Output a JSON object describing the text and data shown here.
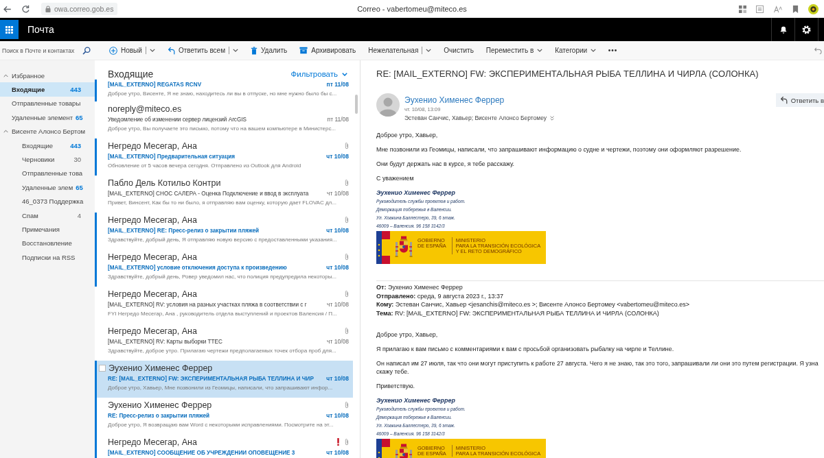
{
  "browser": {
    "url": "owa.correo.gob.es",
    "title": "Correo - vabertomeu@miteco.es"
  },
  "app_bar": {
    "title": "Почта"
  },
  "toolbar": {
    "search": {
      "placeholder": "Поиск в Почте и контактах"
    },
    "buttons": [
      {
        "kind": "new",
        "label": "Новый"
      },
      {
        "kind": "replyall",
        "label": "Ответить всем"
      },
      {
        "kind": "delete",
        "label": "Удалить"
      },
      {
        "kind": "archive",
        "label": "Архивировать"
      },
      {
        "kind": "junk",
        "label": "Нежелательная"
      },
      {
        "kind": "sweep",
        "label": "Очистить"
      },
      {
        "kind": "move",
        "label": "Переместить в"
      },
      {
        "kind": "categories",
        "label": "Категории"
      },
      {
        "kind": "more"
      }
    ]
  },
  "folder_pane": {
    "sections": [
      {
        "kind": "favorites",
        "label": "Избранное",
        "expanded": true,
        "children": [
          {
            "label": "Входящие",
            "count": "443",
            "count_unread": true,
            "selected": true
          },
          {
            "label": "Отправленные товары",
            "selected": false
          },
          {
            "label": "Удаленные элемент",
            "count": "65",
            "count_unread": true,
            "selected": false
          }
        ]
      },
      {
        "kind": "account",
        "label": "Висенте Алонсо Бертом",
        "expanded": true,
        "children": [
          {
            "label": "Входящие",
            "count": "443",
            "count_unread": true,
            "selected": false
          },
          {
            "label": "Черновики",
            "count": "30",
            "count_unread": false,
            "selected": false
          },
          {
            "label": "Отправленные това",
            "selected": false
          },
          {
            "label": "Удаленные элем",
            "count": "65",
            "count_unread": true,
            "selected": false
          },
          {
            "label": "46_0373 Поддержка",
            "selected": false
          },
          {
            "label": "Спам",
            "count": "4",
            "count_unread": false,
            "selected": false
          },
          {
            "label": "Примечания",
            "selected": false
          },
          {
            "label": "Восстановление",
            "selected": false
          },
          {
            "label": "Подписки на RSS",
            "selected": false
          }
        ]
      }
    ]
  },
  "message_list": {
    "title": "Входящие",
    "filter": "Фильтровать",
    "messages": [
      {
        "subject": "[MAIL_EXTERNO] REGATAS RCNV",
        "date": "пт 11/08",
        "preview": "Доброе утро, Висенте, Я не знаю, находитесь ли вы в отпуске, но мне нужно было бы с...",
        "unread": true,
        "selected": false,
        "attachment": false,
        "important": false
      },
      {
        "sender": "noreply@miteco.es",
        "subject": "Уведомление об изменении сервер лицензий ArcGIS",
        "date": "пт 11/08",
        "preview": "Доброе утро, Вы получаете это письмо, потому что на вашем компьютере в Министерс...",
        "unread": false,
        "selected": false,
        "attachment": false,
        "important": false
      },
      {
        "sender": "Негредо Месегар, Ана",
        "subject": "[MAIL_EXTERNO] Предварительная ситуация",
        "date": "чт 10/08",
        "preview": "Обновление от 5 часов вечера сегодня. Отправлено из Outlook для Android",
        "unread": true,
        "selected": false,
        "attachment": true,
        "important": false
      },
      {
        "sender": "Пабло Дель Котильо Контри",
        "subject": "[MAIL_EXTERNO] СНОС САЛЕРА - Оценка Подключение и ввод в эксплуата",
        "date": "чт 10/08",
        "preview": "Привет, Винсент, Как бы то ни было, я отправляю вам оценку, которую дает FLOVAC дл...",
        "unread": false,
        "selected": false,
        "attachment": true,
        "important": false
      },
      {
        "sender": "Негредо Месегар, Ана",
        "subject": "[MAIL_EXTERNO] RE: Пресс-релиз о закрытии пляжей",
        "date": "чт 10/08",
        "preview": "Здравствуйте, добрый день, Я отправляю новую версию с предоставленными указания...",
        "unread": true,
        "selected": false,
        "attachment": true,
        "important": false
      },
      {
        "sender": "Негредо Месегар, Ана",
        "subject": "[MAIL_EXTERNO] условие отключения доступа к произведению",
        "date": "чт 10/08",
        "preview": "Здравствуйте, добрый день, Ровер уведомил нас, что полиция предупредила некоторы...",
        "unread": true,
        "selected": false,
        "attachment": true,
        "important": false
      },
      {
        "sender": "Негредо Месегар, Ана",
        "subject": "[MAIL_EXTERNO] RV: условия на разных участках пляжа в соответствии с г",
        "date": "чт 10/08",
        "preview": "FYI Негредо Месегар, Ана , руководитель отдела выступлений и проектов Валенсия / П...",
        "unread": false,
        "selected": false,
        "attachment": true,
        "important": false
      },
      {
        "sender": "Негредо Месегар, Ана",
        "subject": "[MAIL_EXTERNO] RV: Карты выборки TTEC",
        "date": "чт 10/08",
        "preview": "Здравствуйте, доброе утро. Прилагаю чертежи предполагаемых точек отбора проб для...",
        "unread": false,
        "selected": false,
        "attachment": true,
        "important": false
      },
      {
        "sender": "Эухенио Хименес Феррер",
        "subject": "RE: [MAIL_EXTERNO] FW: ЭКСПЕРИМЕНТАЛЬНАЯ РЫБА ТЕЛЛИНА И ЧИР",
        "date": "чт 10/08",
        "preview": "Доброе утро, Хавьер, Мне позвонили из Геомицы, написали, что запрашивают инфор...",
        "unread": true,
        "selected": true,
        "attachment": false,
        "important": false
      },
      {
        "sender": "Эухенио Хименес Феррер",
        "subject": "RE: Пресс-релиз о закрытии пляжей",
        "date": "чт 10/08",
        "preview": "Доброе утро, Я возвращаю вам Word с некоторыми исправлениями. Посмотрите на эт...",
        "unread": true,
        "selected": false,
        "attachment": true,
        "important": false
      },
      {
        "sender": "Негредо Месегар, Ана",
        "subject": "[MAIL_EXTERNO] СООБЩЕНИЕ ОБ УЧРЕЖДЕНИИ ОПОВЕЩЕНИЕ 3",
        "date": "чт 10/08",
        "unread": true,
        "selected": false,
        "attachment": true,
        "important": true
      }
    ]
  },
  "reading_pane": {
    "subject": "RE: [MAIL_EXTERNO] FW: ЭКСПЕРИМЕНТАЛЬНАЯ РЫБА ТЕЛЛИНА И ЧИРЛА (СОЛОНКА)",
    "sender": "Эухенио Хименес Феррер",
    "sent": "чт. 10/08, 13:09",
    "recipients": "Эстеван Санчис, Хавьер; Висенте Алонсо Бертомеу",
    "reply_button": "Ответить в",
    "body": [
      {
        "kind": "paragraph",
        "lines": [
          "Доброе утро, Хавьер,"
        ]
      },
      {
        "kind": "paragraph",
        "lines": [
          "Мне позвонили из Геомицы, написали, что запрашивают информацию о судне и чертежи, поэтому они оформляют разрешение."
        ]
      },
      {
        "kind": "paragraph",
        "lines": [
          "Они будут держать нас в курсе, я тебе расскажу."
        ]
      },
      {
        "kind": "paragraph",
        "lines": [
          "С уважением"
        ]
      },
      {
        "kind": "signature",
        "name": "Эухенио Хименес Феррер",
        "lines": [
          "Руководитель службы проектов и работ.",
          "Деморкация побережья в Валенсии.",
          "Ул. Хоакина Баллестеро, 39, 6 этаж.",
          "46009 – Валенсия. 96 158 3142/3"
        ]
      },
      {
        "kind": "logo",
        "left": [
          "GOBIERNO",
          "DE ESPAÑA"
        ],
        "right": [
          "MINISTERIO",
          "PARA LA TRANSICIÓN ECOLÓGICA",
          "Y EL RETO DEMOGRÁFICO"
        ]
      },
      {
        "kind": "headers",
        "fields": [
          {
            "label": "От:",
            "value": "Эухенио Хименес Феррер"
          },
          {
            "label": "Отправлено:",
            "value": "среда, 9 августа 2023 г., 13:37"
          },
          {
            "label": "Кому:",
            "value": "Эстеван Санчис, Хавьер <jesanchis@miteco.es >; Висенте Алонсо Бертомеу <vabertomeu@miteco.es>"
          },
          {
            "label": "Тема:",
            "value": "RV: [MAIL_EXTERNO] FW: ЭКСПЕРИМЕНТАЛЬНАЯ РЫБА ТЕЛЛИНА И ЧИРЛА (СОЛОНКА)"
          }
        ]
      },
      {
        "kind": "paragraph",
        "lines": [
          "Доброе утро, Хавьер,"
        ]
      },
      {
        "kind": "paragraph",
        "lines": [
          "Я прилагаю к вам письмо с комментариями к вам с просьбой организовать рыбалку на чирле и Теллине."
        ]
      },
      {
        "kind": "paragraph",
        "lines": [
          "Он написал им 27 июля, так что они могут приступить к работе 27 августа. Чего я не знаю, так это того, запрашивали ли они это путем регистрации. Я узна",
          "скажу тебе."
        ]
      },
      {
        "kind": "paragraph",
        "lines": [
          "Приветствую."
        ]
      },
      {
        "kind": "signature",
        "name": "Эухенио Хименес Феррер",
        "lines": [
          "Руководитель службы проектов и работ.",
          "Деморкация побережья в Валенсии.",
          "Ул. Хоакина Баллестеро, 39, 6 этаж.",
          "46009 – Валенсия. 96 158 3142/3"
        ]
      },
      {
        "kind": "logo",
        "left": [
          "GOBIERNO",
          "DE ESPAÑA"
        ],
        "right": [
          "MINISTERIO",
          "PARA LA TRANSICIÓN ECOLÓGICA"
        ]
      }
    ]
  }
}
